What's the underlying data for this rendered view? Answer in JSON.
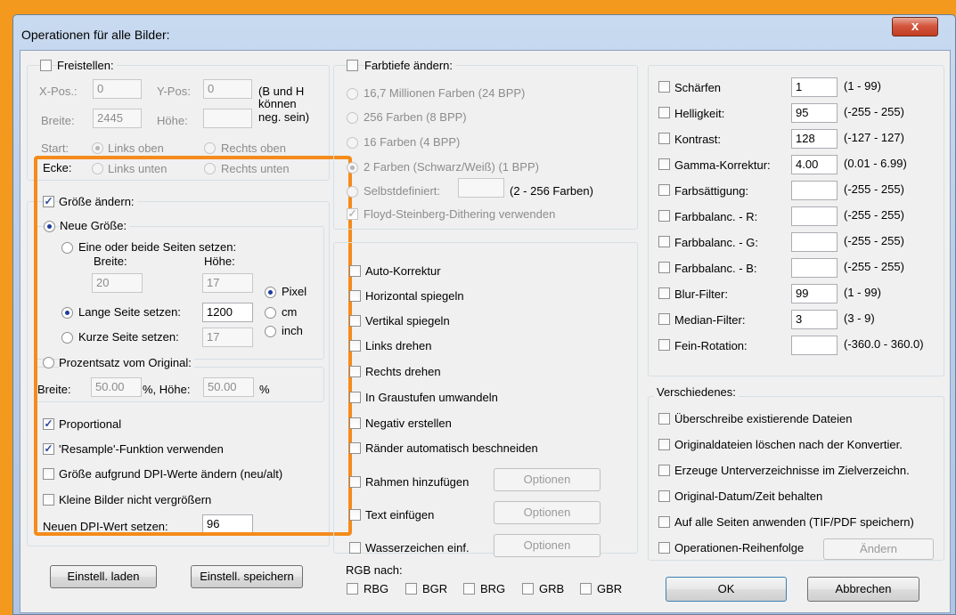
{
  "window": {
    "title": "Operationen für alle Bilder:",
    "close": "x"
  },
  "crop": {
    "label": "Freistellen:",
    "xpos_label": "X-Pos.:",
    "xpos_value": "0",
    "ypos_label": "Y-Pos:",
    "ypos_value": "0",
    "hint": [
      "(B und H",
      "können",
      "neg. sein)"
    ],
    "width_label": "Breite:",
    "width_value": "2445",
    "height_label": "Höhe:",
    "height_value": "",
    "start_label": "Start:",
    "top_left": "Links oben",
    "top_right": "Rechts oben",
    "corner_label": "Ecke:",
    "bottom_left": "Links unten",
    "bottom_right": "Rechts unten"
  },
  "resize": {
    "label": "Größe ändern:",
    "new_size": "Neue Größe:",
    "one_or_both": "Eine oder beide Seiten setzen:",
    "width_label": "Breite:",
    "height_label": "Höhe:",
    "width_value": "20",
    "height_value": "17",
    "long_side": "Lange Seite setzen:",
    "long_value": "1200",
    "short_side": "Kurze Seite setzen:",
    "short_value": "17",
    "units": [
      "Pixel",
      "cm",
      "inch"
    ],
    "percent": "Prozentsatz vom Original:",
    "pct_width_label": "Breite:",
    "pct_width_value": "50.00",
    "pct_mid": "%,  Höhe:",
    "pct_height_value": "50.00",
    "pct_end": "%",
    "proportional": "Proportional",
    "resample": "'Resample'-Funktion verwenden",
    "dpi_resize": "Größe aufgrund DPI-Werte ändern (neu/alt)",
    "no_enlarge": "Kleine Bilder nicht vergrößern",
    "new_dpi_label": "Neuen DPI-Wert setzen:",
    "new_dpi_value": "96"
  },
  "left_buttons": {
    "load": "Einstell. laden",
    "save": "Einstell. speichern"
  },
  "colordepth": {
    "label": "Farbtiefe ändern:",
    "options": [
      "16,7 Millionen Farben (24 BPP)",
      "256 Farben (8 BPP)",
      "16 Farben (4 BPP)",
      "2 Farben (Schwarz/Weiß) (1 BPP)",
      "Selbstdefiniert:"
    ],
    "custom_range": "(2 - 256 Farben)",
    "dithering": "Floyd-Steinberg-Dithering verwenden"
  },
  "ops": {
    "items": [
      "Auto-Korrektur",
      "Horizontal spiegeln",
      "Vertikal spiegeln",
      "Links drehen",
      "Rechts drehen",
      "In Graustufen umwandeln",
      "Negativ erstellen",
      "Ränder automatisch beschneiden",
      "Rahmen hinzufügen",
      "Text einfügen",
      "Wasserzeichen einf."
    ],
    "options_button": "Optionen"
  },
  "rgb": {
    "label": "RGB nach:",
    "items": [
      "RBG",
      "BGR",
      "BRG",
      "GRB",
      "GBR"
    ]
  },
  "filters": [
    {
      "label": "Schärfen",
      "value": "1",
      "range": "(1 - 99)"
    },
    {
      "label": "Helligkeit:",
      "value": "95",
      "range": "(-255 - 255)"
    },
    {
      "label": "Kontrast:",
      "value": "128",
      "range": "(-127 - 127)"
    },
    {
      "label": "Gamma-Korrektur:",
      "value": "4.00",
      "range": "(0.01 - 6.99)"
    },
    {
      "label": "Farbsättigung:",
      "value": "",
      "range": "(-255 - 255)"
    },
    {
      "label": "Farbbalanc. - R:",
      "value": "",
      "range": "(-255 - 255)"
    },
    {
      "label": "Farbbalanc. - G:",
      "value": "",
      "range": "(-255 - 255)"
    },
    {
      "label": "Farbbalanc. - B:",
      "value": "",
      "range": "(-255 - 255)"
    },
    {
      "label": "Blur-Filter:",
      "value": "99",
      "range": "(1 - 99)"
    },
    {
      "label": "Median-Filter:",
      "value": "3",
      "range": "(3 - 9)"
    },
    {
      "label": "Fein-Rotation:",
      "value": "",
      "range": "(-360.0 - 360.0)"
    }
  ],
  "misc": {
    "label": "Verschiedenes:",
    "items": [
      "Überschreibe existierende Dateien",
      "Originaldateien löschen nach der Konvertier.",
      "Erzeuge Unterverzeichnisse im Zielverzeichn.",
      "Original-Datum/Zeit behalten",
      "Auf alle Seiten anwenden (TIF/PDF speichern)",
      "Operationen-Reihenfolge"
    ],
    "change_button": "Ändern"
  },
  "footer": {
    "ok": "OK",
    "cancel": "Abbrechen"
  },
  "colors": {
    "highlight": "#f48b1b",
    "backdrop": "#f39a1e",
    "check": "#2a4a9a"
  }
}
